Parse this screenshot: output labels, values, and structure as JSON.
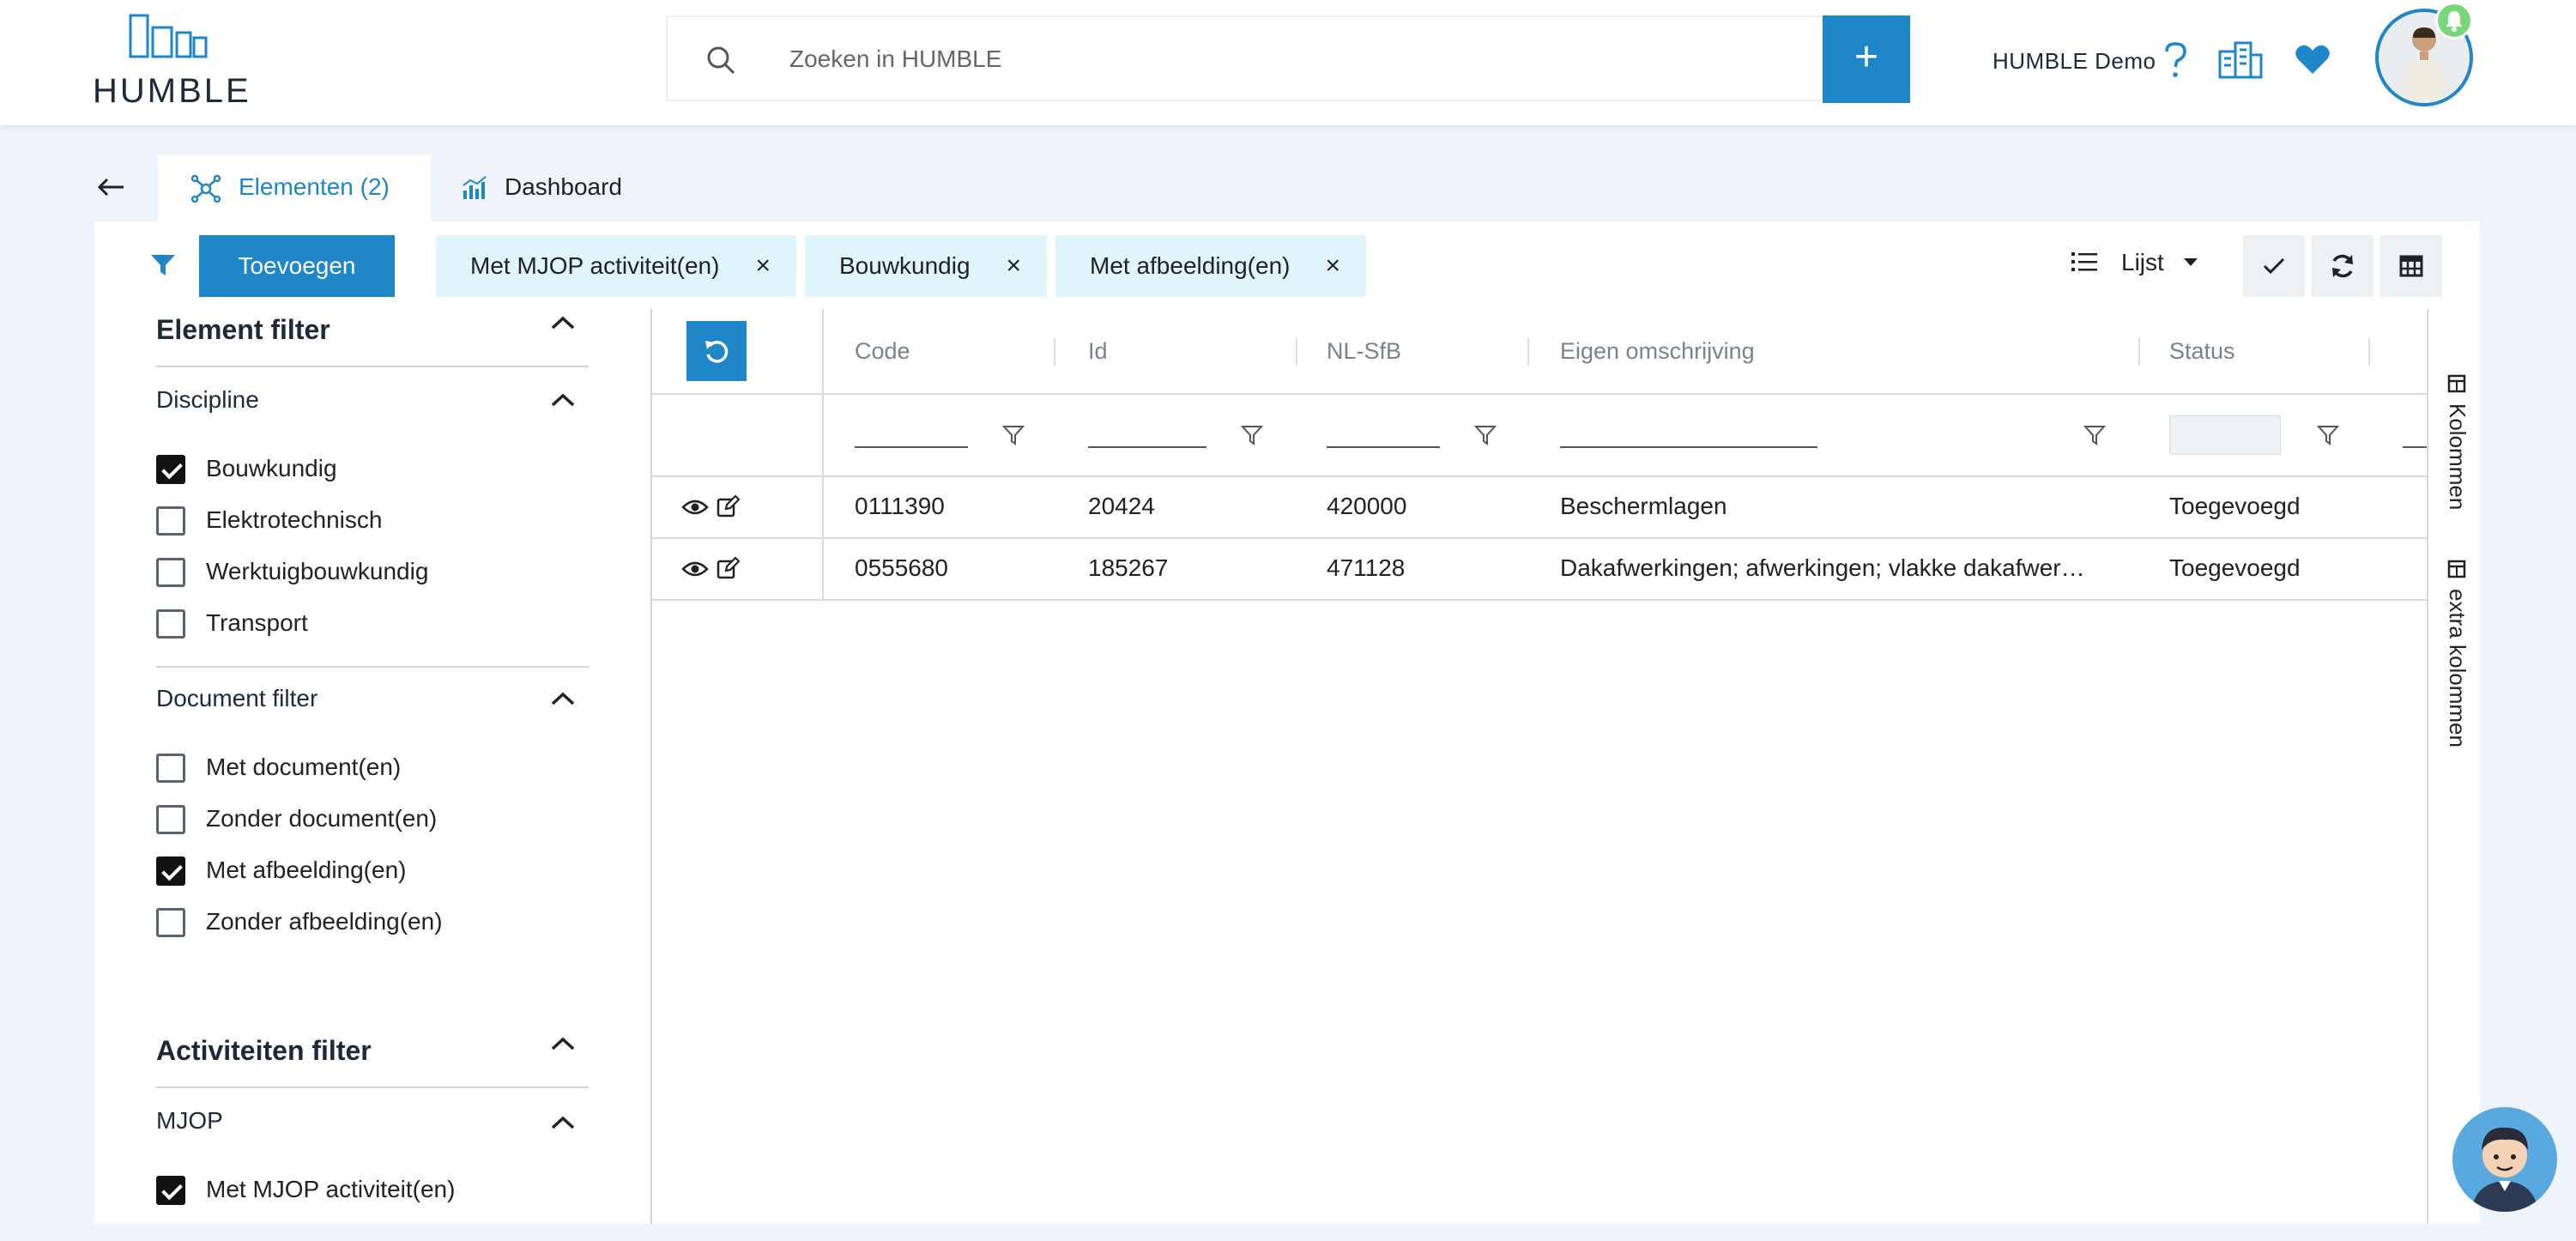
{
  "header": {
    "logo_text": "HUMBLE",
    "search_placeholder": "Zoeken in HUMBLE",
    "add_label": "+",
    "user_label": "HUMBLE Demo"
  },
  "tabs": [
    {
      "label": "Elementen (2)",
      "active": true
    },
    {
      "label": "Dashboard",
      "active": false
    }
  ],
  "toolbar": {
    "add_button": "Toevoegen",
    "chips": [
      "Met MJOP activiteit(en)",
      "Bouwkundig",
      "Met afbeelding(en)"
    ],
    "chip_close": "×",
    "view_label": "Lijst"
  },
  "sidebar": {
    "element_filter": "Element filter",
    "discipline": {
      "title": "Discipline",
      "options": [
        {
          "label": "Bouwkundig",
          "checked": true
        },
        {
          "label": "Elektrotechnisch",
          "checked": false
        },
        {
          "label": "Werktuigbouwkundig",
          "checked": false
        },
        {
          "label": "Transport",
          "checked": false
        }
      ]
    },
    "document_filter": {
      "title": "Document filter",
      "options": [
        {
          "label": "Met document(en)",
          "checked": false
        },
        {
          "label": "Zonder document(en)",
          "checked": false
        },
        {
          "label": "Met afbeelding(en)",
          "checked": true
        },
        {
          "label": "Zonder afbeelding(en)",
          "checked": false
        }
      ]
    },
    "activity_filter": "Activiteiten filter",
    "mjop": {
      "title": "MJOP",
      "options": [
        {
          "label": "Met MJOP activiteit(en)",
          "checked": true
        }
      ]
    }
  },
  "grid": {
    "columns": [
      "Code",
      "Id",
      "NL-SfB",
      "Eigen omschrijving",
      "Status"
    ],
    "rows": [
      {
        "code": "0111390",
        "id": "20424",
        "nlsfb": "420000",
        "omschrijving": "Beschermlagen",
        "status": "Toegevoegd"
      },
      {
        "code": "0555680",
        "id": "185267",
        "nlsfb": "471128",
        "omschrijving": "Dakafwerkingen; afwerkingen; vlakke dakafwer…",
        "status": "Toegevoegd"
      }
    ]
  },
  "right_panel": {
    "kolommen": "Kolommen",
    "extra_kolommen": "extra kolommen"
  }
}
